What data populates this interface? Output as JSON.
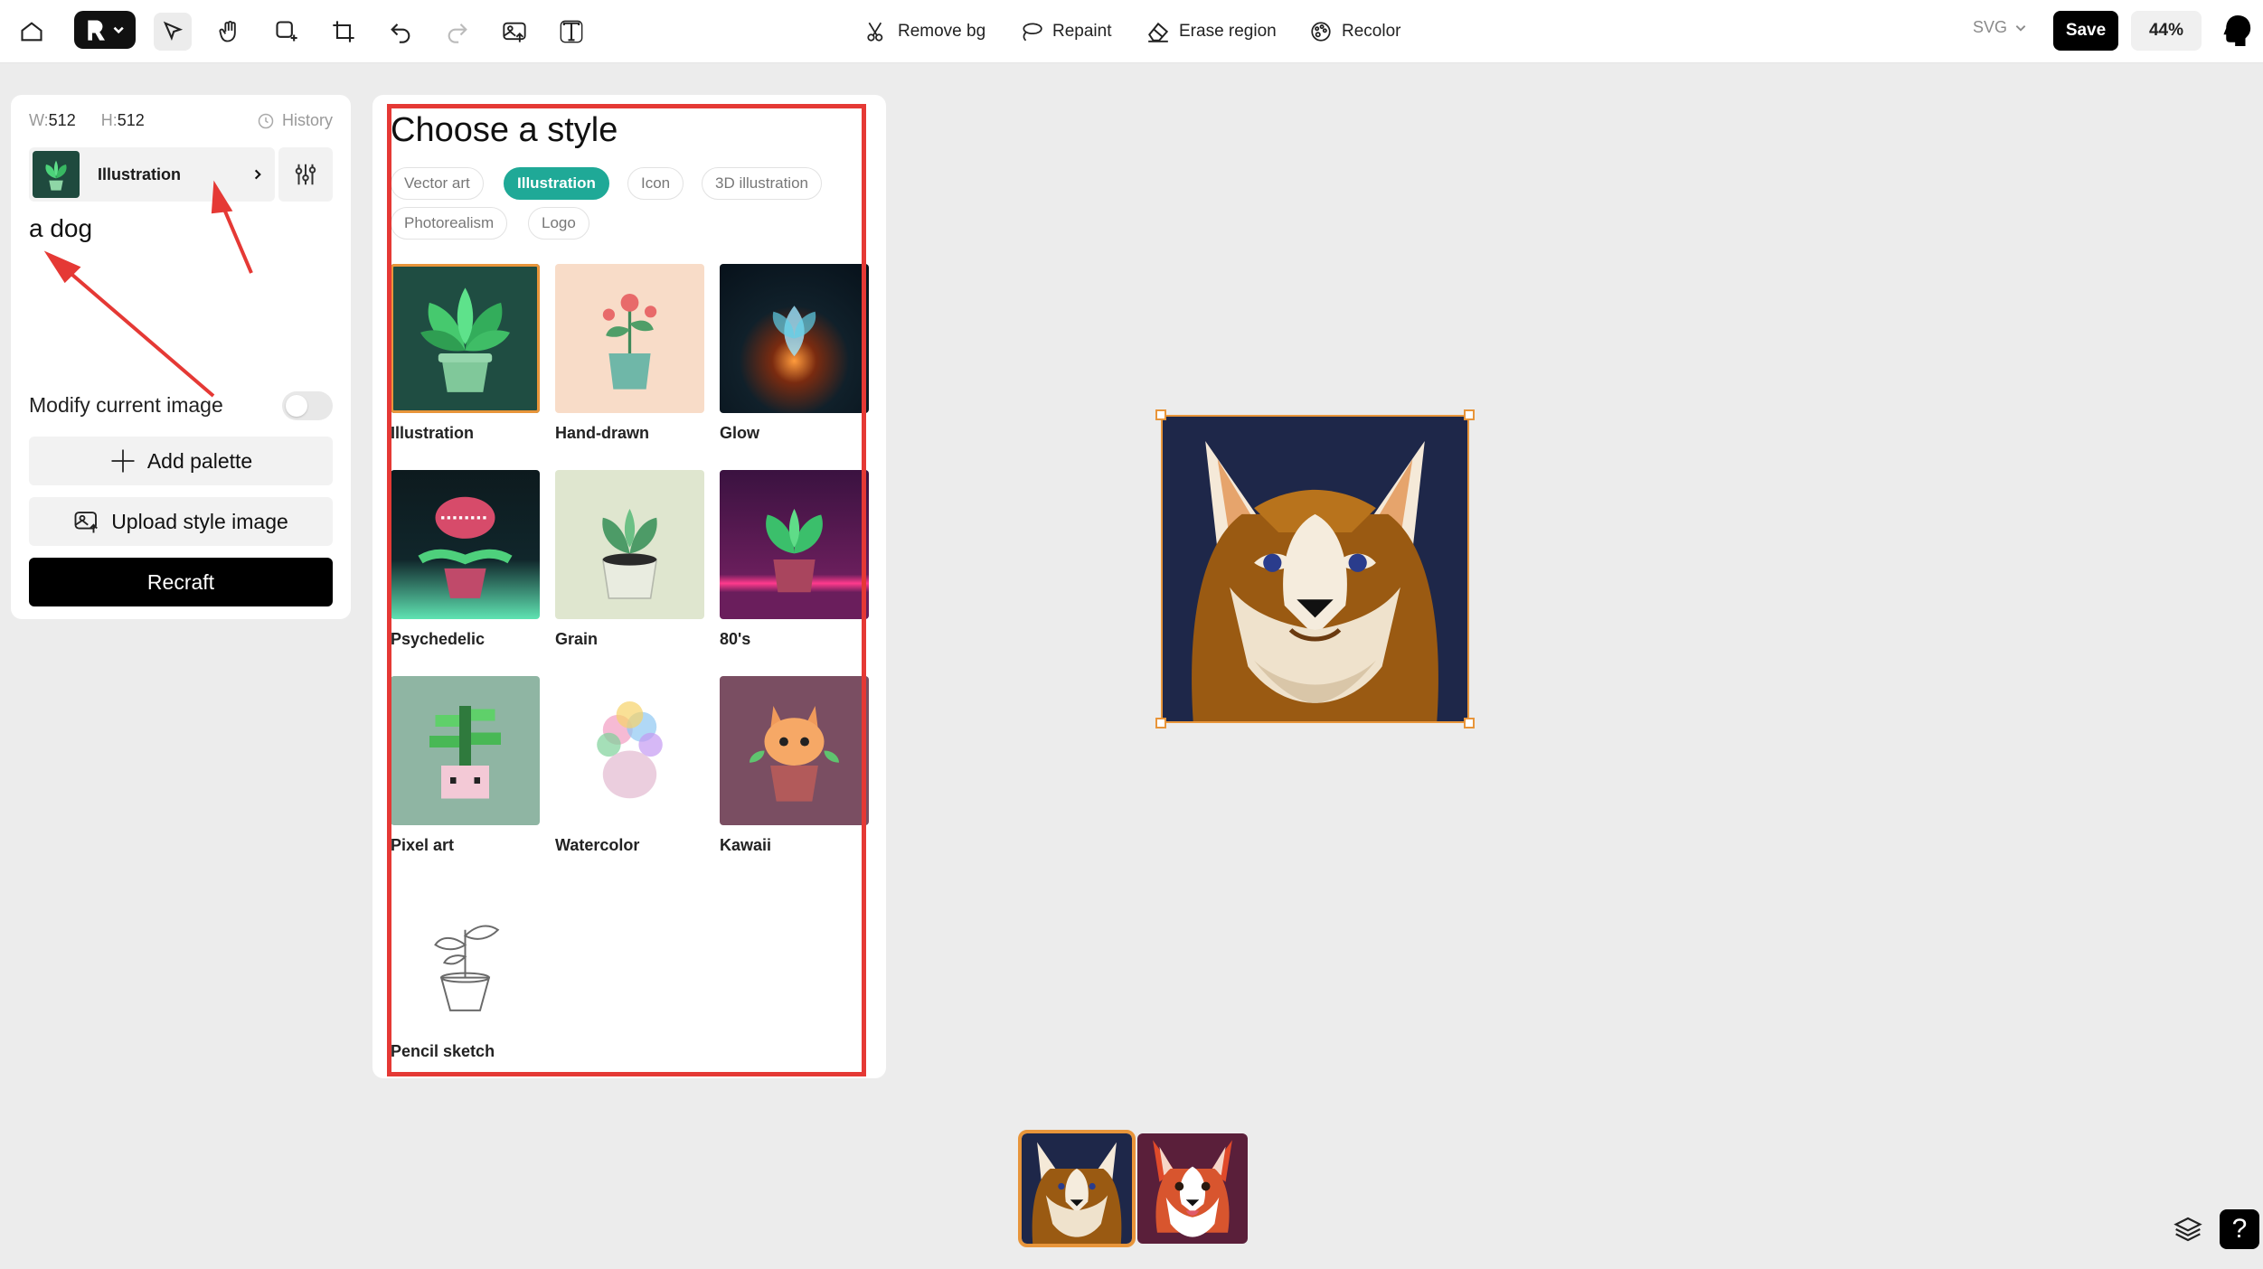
{
  "toolbar": {
    "actions": [
      {
        "label": "Remove bg",
        "icon": "scissors-icon"
      },
      {
        "label": "Repaint",
        "icon": "lasso-icon"
      },
      {
        "label": "Erase region",
        "icon": "eraser-icon"
      },
      {
        "label": "Recolor",
        "icon": "palette-icon"
      }
    ],
    "format": "SVG",
    "save_label": "Save",
    "zoom": "44%"
  },
  "left_panel": {
    "width_label": "W:",
    "width_value": "512",
    "height_label": "H:",
    "height_value": "512",
    "history_label": "History",
    "style_name": "Illustration",
    "prompt": "a dog",
    "modify_label": "Modify current image",
    "modify_enabled": false,
    "add_palette_label": "Add palette",
    "upload_style_label": "Upload style image",
    "recraft_label": "Recraft"
  },
  "style_panel": {
    "title": "Choose a style",
    "categories": [
      {
        "label": "Vector art",
        "active": false
      },
      {
        "label": "Illustration",
        "active": true
      },
      {
        "label": "Icon",
        "active": false
      },
      {
        "label": "3D illustration",
        "active": false
      },
      {
        "label": "Photorealism",
        "active": false
      },
      {
        "label": "Logo",
        "active": false
      }
    ],
    "styles": [
      {
        "name": "Illustration",
        "selected": true
      },
      {
        "name": "Hand-drawn",
        "selected": false
      },
      {
        "name": "Glow",
        "selected": false
      },
      {
        "name": "Psychedelic",
        "selected": false
      },
      {
        "name": "Grain",
        "selected": false
      },
      {
        "name": "80's",
        "selected": false
      },
      {
        "name": "Pixel art",
        "selected": false
      },
      {
        "name": "Watercolor",
        "selected": false
      },
      {
        "name": "Kawaii",
        "selected": false
      },
      {
        "name": "Pencil sketch",
        "selected": false
      }
    ]
  },
  "colors": {
    "accent": "#1fa997",
    "selection": "#e8953a",
    "annotation": "#e53935"
  },
  "help_label": "?"
}
